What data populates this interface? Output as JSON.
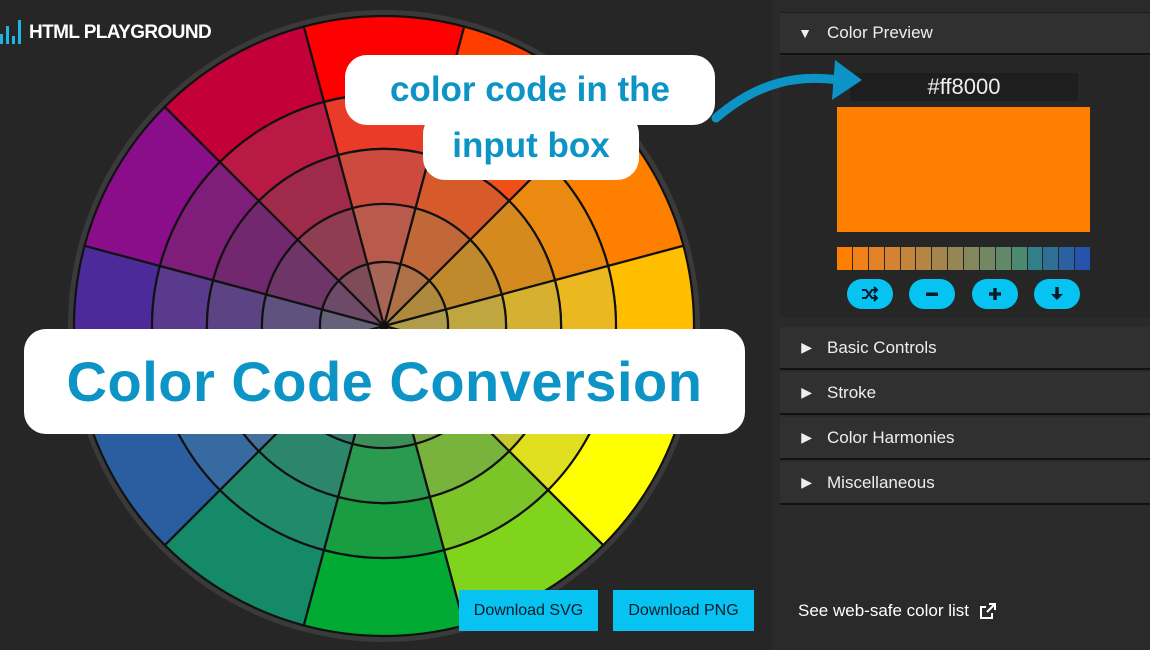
{
  "app": {
    "logo_text": "HTML PLAYGROUND"
  },
  "overlays": {
    "title": "Color Code Conversion",
    "callout_line1": "color code in the",
    "callout_line2": "input box"
  },
  "wheel": {
    "outer_colors": [
      "#ff0000",
      "#ff3d00",
      "#ff8000",
      "#ffbf00",
      "#ffff00",
      "#80d41c",
      "#00aa33",
      "#148a68",
      "#2a5ea0",
      "#4c2a9a",
      "#8a0d8a",
      "#c40038"
    ],
    "middle_colors": [
      "#ea3a28",
      "#ee5018",
      "#eb8a10",
      "#ebb820",
      "#e0e020",
      "#7cc528",
      "#189e40",
      "#208a6a",
      "#366aa0",
      "#5a3a8c",
      "#7e1e7a",
      "#b81a44"
    ],
    "inner_colors": [
      "#cc4a3e",
      "#d65a2a",
      "#d48a1e",
      "#d6b030",
      "#c8c830",
      "#78b33c",
      "#2a9a50",
      "#2c866a",
      "#44709a",
      "#5c4484",
      "#72286e",
      "#a02a4a"
    ],
    "core_colors": [
      "#b85a4c",
      "#c06838",
      "#bf8a2c",
      "#c0a63e",
      "#b6b43e",
      "#7aa448",
      "#3a9058",
      "#3a806e",
      "#507898",
      "#60527e",
      "#6e3668",
      "#8e3e50"
    ],
    "center_colors": [
      "#a86456",
      "#ae7046",
      "#ae8a3c",
      "#b09c4a",
      "#a8a84a",
      "#789654",
      "#4a8a60",
      "#487e72",
      "#5c7e92",
      "#666078",
      "#6c4a68",
      "#7e4c58"
    ]
  },
  "buttons": {
    "download_svg": "Download SVG",
    "download_png": "Download PNG"
  },
  "panel": {
    "color_preview_label": "Color Preview",
    "hex_value": "#ff8000",
    "preview_color": "#ff8000",
    "shades": [
      "#ff8000",
      "#f18119",
      "#e38227",
      "#d48332",
      "#c5843c",
      "#b58544",
      "#a6854c",
      "#968654",
      "#84875b",
      "#738762",
      "#608869",
      "#4b8970",
      "#327e8a",
      "#2f6f96",
      "#2b61a1",
      "#2653ab"
    ],
    "tool_icons": [
      "shuffle-icon",
      "minus-icon",
      "plus-icon",
      "arrow-down-icon"
    ],
    "sections": [
      "Basic Controls",
      "Stroke",
      "Color Harmonies",
      "Miscellaneous"
    ],
    "web_safe_link": "See web-safe color list"
  },
  "colors": {
    "accent": "#06c3f1",
    "callout_text": "#0b94c5",
    "background": "#262626"
  }
}
